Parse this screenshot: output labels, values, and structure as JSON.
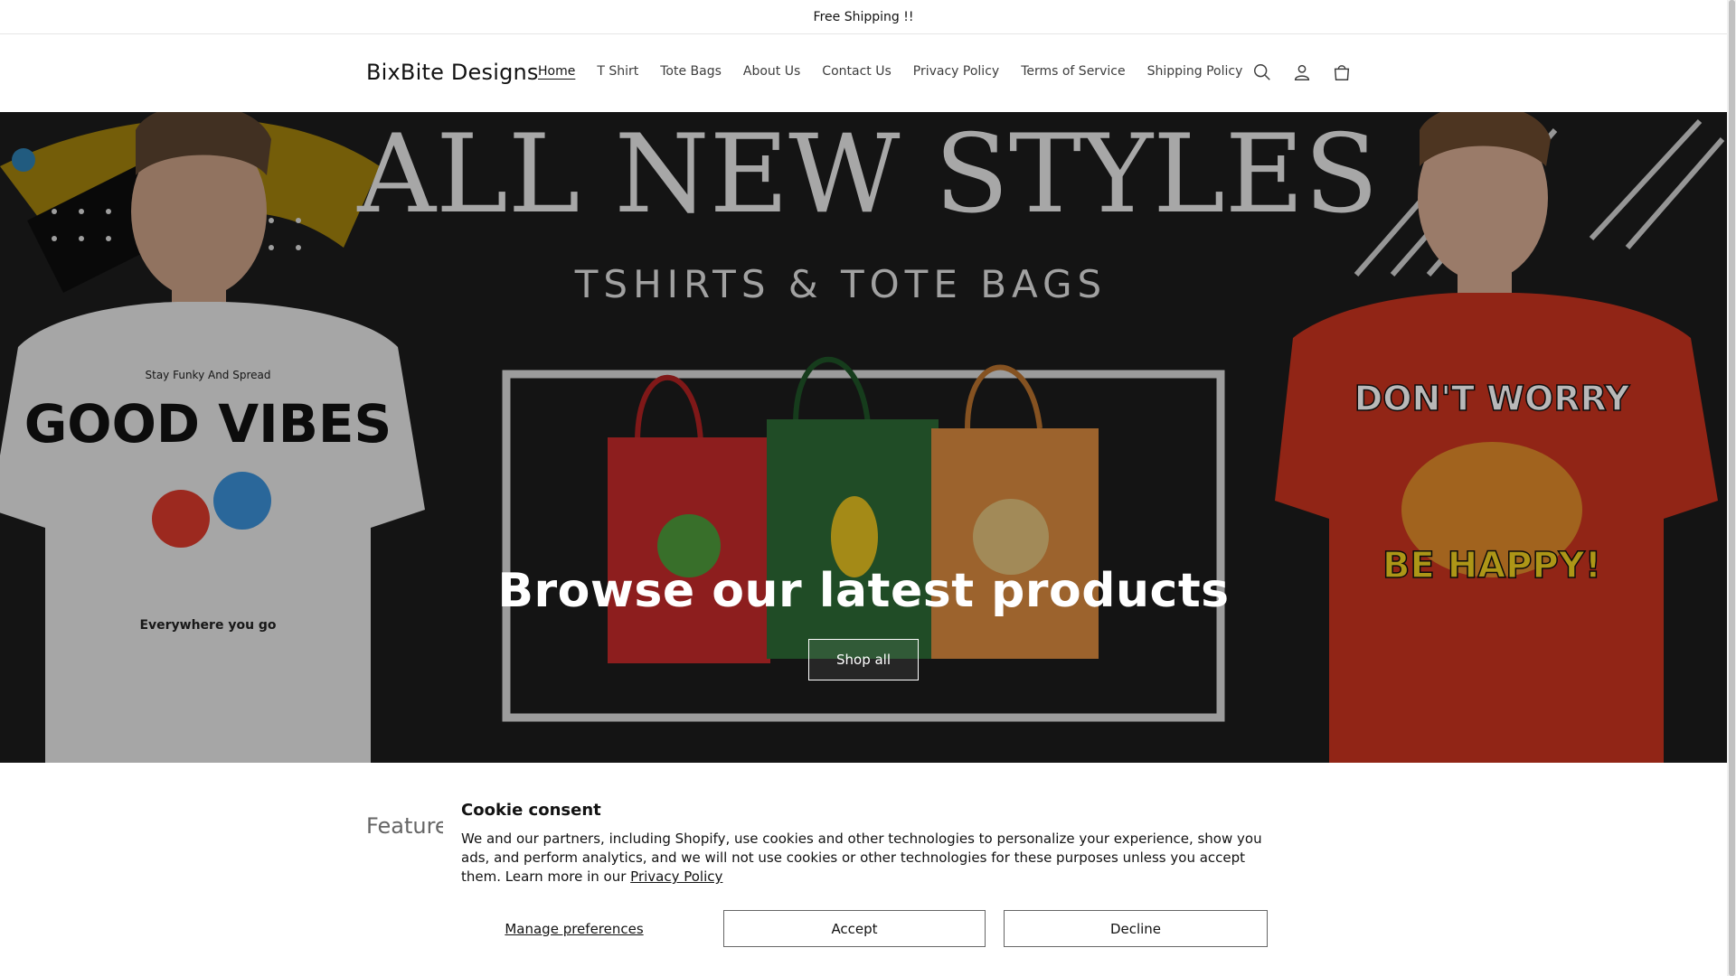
{
  "announcement": "Free Shipping !!",
  "header": {
    "logo": "BixBite Designs",
    "nav": [
      {
        "label": "Home",
        "active": true
      },
      {
        "label": "T Shirt"
      },
      {
        "label": "Tote Bags"
      },
      {
        "label": "About Us"
      },
      {
        "label": "Contact Us"
      },
      {
        "label": "Privacy Policy"
      },
      {
        "label": "Terms of Service"
      },
      {
        "label": "Shipping Policy"
      }
    ],
    "icons": [
      "search-icon",
      "account-icon",
      "cart-icon"
    ]
  },
  "hero": {
    "image_text_top": "ALL NEW STYLES",
    "image_text_sub": "TSHIRTS & TOTE BAGS",
    "shirt_left_text": [
      "Stay Funky And Spread",
      "GOOD VIBES",
      "Everywhere you go"
    ],
    "shirt_right_text": [
      "DON'T WORRY",
      "BE HAPPY!"
    ],
    "title": "Browse our latest products",
    "button": "Shop all"
  },
  "featured_heading_partial": "Feature",
  "cookie": {
    "title": "Cookie consent",
    "body": "We and our partners, including Shopify, use cookies and other technologies to personalize your experience, show you ads, and perform analytics, and we will not use cookies or other technologies for these purposes unless you accept them. Learn more in our ",
    "policy_link": "Privacy Policy",
    "manage": "Manage preferences",
    "accept": "Accept",
    "decline": "Decline"
  },
  "colors": {
    "hero_bg": "#1a1a1a",
    "shirt_left": "#e8e8e8",
    "shirt_right": "#c9341f",
    "bag_red": "#c42a2a",
    "bag_green": "#2d6a35",
    "bag_orange": "#d9893f",
    "accent_yellow": "#e6b800"
  }
}
